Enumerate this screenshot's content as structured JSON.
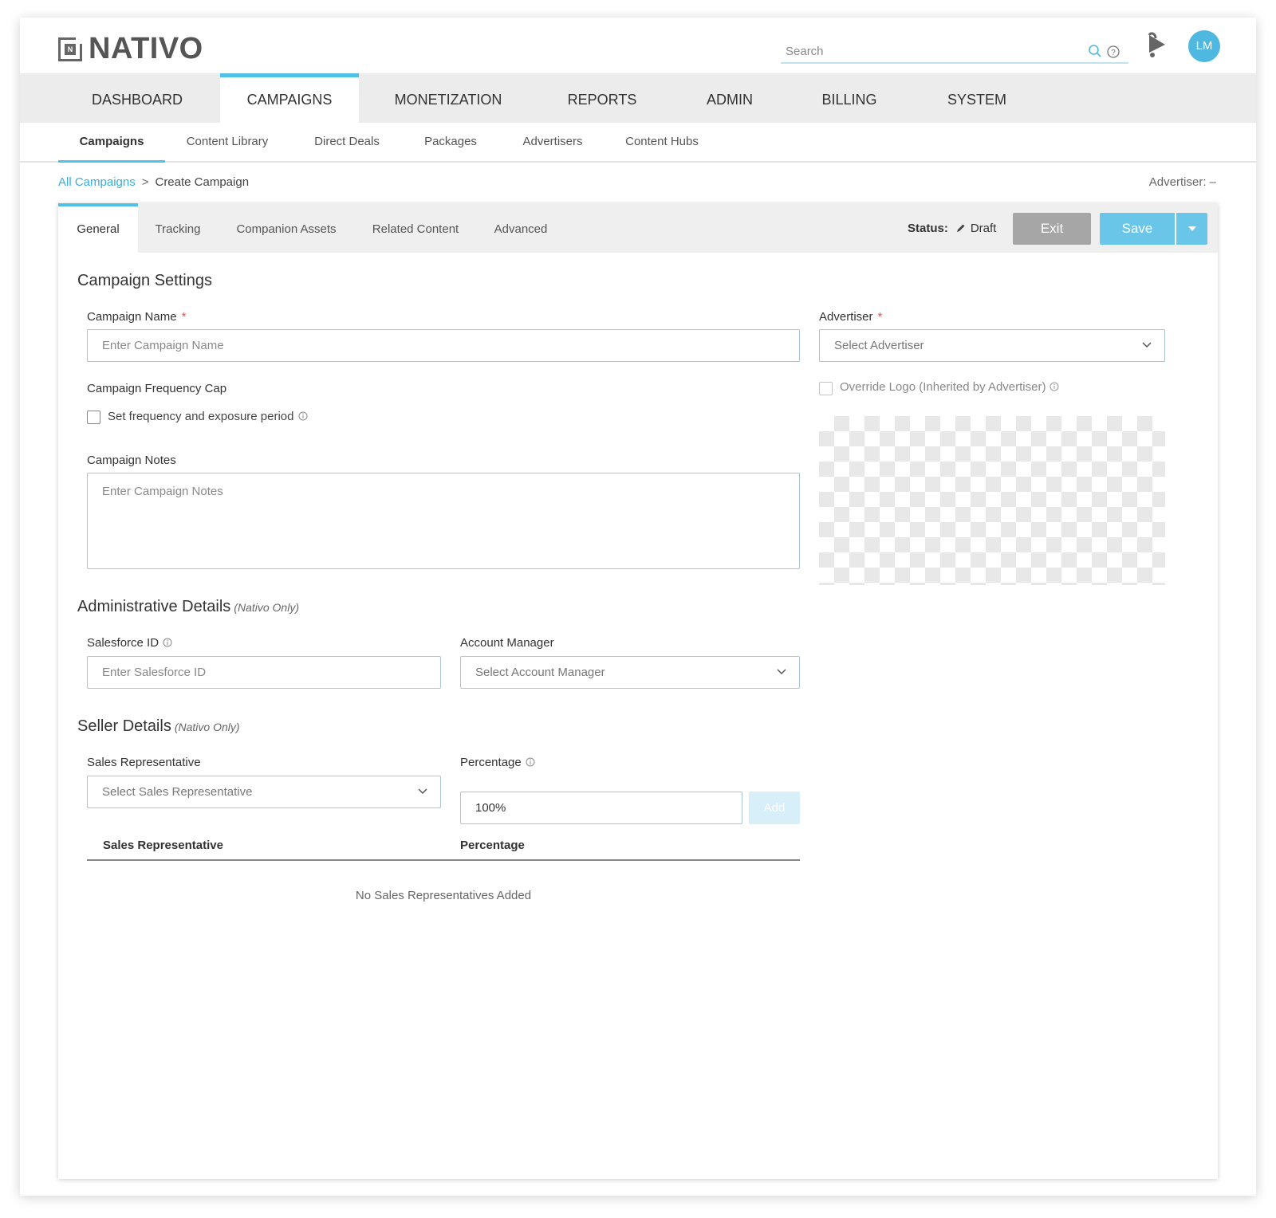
{
  "header": {
    "brand": "NATIVO",
    "logo_letter": "N",
    "search_placeholder": "Search",
    "avatar_initials": "LM"
  },
  "main_nav": [
    {
      "label": "DASHBOARD"
    },
    {
      "label": "CAMPAIGNS",
      "active": true
    },
    {
      "label": "MONETIZATION"
    },
    {
      "label": "REPORTS"
    },
    {
      "label": "ADMIN"
    },
    {
      "label": "BILLING"
    },
    {
      "label": "SYSTEM"
    }
  ],
  "sub_nav": [
    {
      "label": "Campaigns",
      "active": true
    },
    {
      "label": "Content Library"
    },
    {
      "label": "Direct Deals"
    },
    {
      "label": "Packages"
    },
    {
      "label": "Advertisers"
    },
    {
      "label": "Content Hubs"
    }
  ],
  "breadcrumb": {
    "link": "All Campaigns",
    "separator": ">",
    "current": "Create Campaign"
  },
  "advertiser_meta": "Advertiser: –",
  "tabs": [
    {
      "label": "General",
      "active": true
    },
    {
      "label": "Tracking"
    },
    {
      "label": "Companion Assets"
    },
    {
      "label": "Related Content"
    },
    {
      "label": "Advanced"
    }
  ],
  "status": {
    "label": "Status:",
    "value": "Draft"
  },
  "actions": {
    "exit": "Exit",
    "save": "Save"
  },
  "campaign_settings": {
    "title": "Campaign Settings",
    "name_label": "Campaign Name",
    "name_placeholder": "Enter Campaign Name",
    "required_mark": "*",
    "advertiser_label": "Advertiser",
    "advertiser_placeholder": "Select Advertiser",
    "freq_cap_label": "Campaign Frequency Cap",
    "freq_cap_checkbox": "Set frequency and exposure period",
    "override_logo": "Override Logo (Inherited by Advertiser)",
    "notes_label": "Campaign Notes",
    "notes_placeholder": "Enter Campaign Notes"
  },
  "admin_details": {
    "title": "Administrative Details",
    "note": "(Nativo Only)",
    "salesforce_label": "Salesforce ID",
    "salesforce_placeholder": "Enter Salesforce ID",
    "account_manager_label": "Account Manager",
    "account_manager_placeholder": "Select Account Manager"
  },
  "seller_details": {
    "title": "Seller Details",
    "note": "(Nativo Only)",
    "sales_rep_label": "Sales Representative",
    "sales_rep_placeholder": "Select Sales Representative",
    "percentage_label": "Percentage",
    "percentage_value": "100%",
    "add_button": "Add",
    "table_columns": [
      "Sales Representative",
      "Percentage"
    ],
    "empty_message": "No Sales Representatives Added"
  }
}
